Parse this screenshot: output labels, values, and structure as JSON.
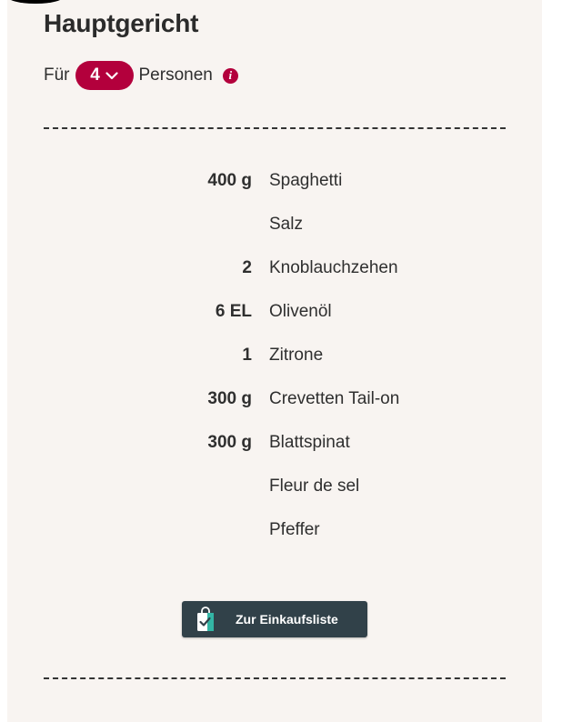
{
  "recipe": {
    "section_title": "Hauptgericht",
    "servings": {
      "prefix": "Für",
      "count": "4",
      "suffix": "Personen"
    },
    "ingredients": [
      {
        "qty": "400 g",
        "name": "Spaghetti"
      },
      {
        "qty": "",
        "name": "Salz"
      },
      {
        "qty": "2",
        "name": "Knoblauchzehen"
      },
      {
        "qty": "6 EL",
        "name": "Olivenöl"
      },
      {
        "qty": "1",
        "name": "Zitrone"
      },
      {
        "qty": "300 g",
        "name": "Crevetten Tail-on"
      },
      {
        "qty": "300 g",
        "name": "Blattspinat"
      },
      {
        "qty": "",
        "name": "Fleur de sel"
      },
      {
        "qty": "",
        "name": "Pfeffer"
      }
    ],
    "shopping_button_label": "Zur Einkaufsliste"
  },
  "icons": {
    "servings_dropdown": "chevron-down-icon",
    "info": "info-icon",
    "shopping": "shopping-bag-check-icon"
  },
  "colors": {
    "accent": "#b3003c",
    "button_bg": "#314149",
    "panel_bg": "#f8f4f1",
    "icon_teal": "#33b5a5"
  }
}
